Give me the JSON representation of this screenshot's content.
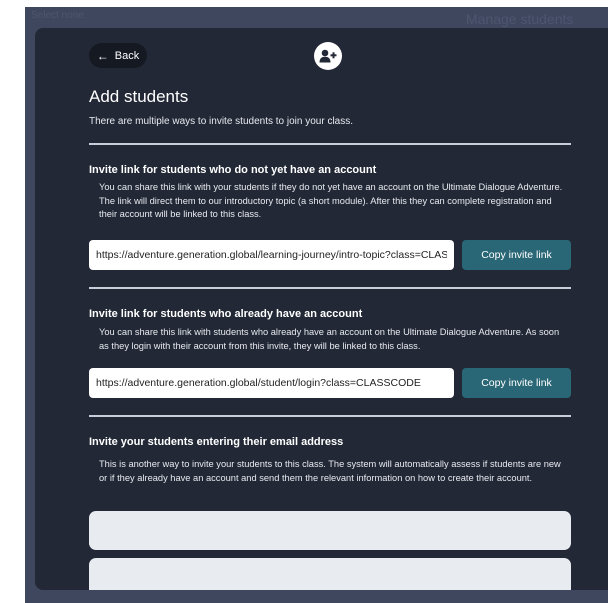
{
  "background": {
    "left_text": "Select none",
    "right_text": "Manage students"
  },
  "modal": {
    "back_label": "Back",
    "add_icon": "user-plus-icon",
    "title": "Add students",
    "intro": "There are multiple ways to invite students to join your class.",
    "sections": [
      {
        "title": "Invite link for students who do not yet have an account",
        "description": "You can share this link with your students if they do not yet have an account on the Ultimate Dialogue Adventure. The link will direct them to our introductory topic (a short module). After this they can complete registration and their account will be linked to this class.",
        "link": "https://adventure.generation.global/learning-journey/intro-topic?class=CLASSCODE",
        "button": "Copy invite link"
      },
      {
        "title": "Invite link for students who already have an account",
        "description": "You can share this link with students who already have an account on the Ultimate Dialogue Adventure. As soon as they login with their account from this invite, they will be linked to this class.",
        "link": "https://adventure.generation.global/student/login?class=CLASSCODE",
        "button": "Copy invite link"
      },
      {
        "title": "Invite your students entering their email address",
        "description": "This is another way to invite your students to this class. The system will automatically assess if students are new or if they already have an account and send them the relevant information on how to create their account."
      }
    ]
  },
  "colors": {
    "modal_bg": "#222836",
    "backdrop": "#3f475e",
    "accent_button": "#2a6776"
  }
}
